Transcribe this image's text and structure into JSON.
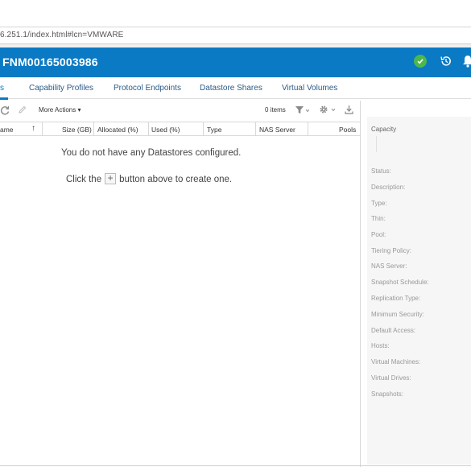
{
  "browser": {
    "address": "6.251.1/index.html#lcn=VMWARE"
  },
  "header": {
    "title": "FNM00165003986"
  },
  "tabs": [
    {
      "label": "s"
    },
    {
      "label": "Capability Profiles"
    },
    {
      "label": "Protocol Endpoints"
    },
    {
      "label": "Datastore Shares"
    },
    {
      "label": "Virtual Volumes"
    }
  ],
  "toolbar": {
    "more_actions": "More Actions",
    "items_count": "0 items"
  },
  "table": {
    "columns": [
      "ame",
      "Size (GB)",
      "Allocated (%)",
      "Used (%)",
      "Type",
      "NAS Server",
      "Pools"
    ]
  },
  "empty": {
    "message": "You do not have any Datastores configured.",
    "create_prefix": "Click the",
    "create_plus": "+",
    "create_suffix": "button above to create one."
  },
  "details": {
    "capacity": "Capacity",
    "properties": [
      "Status:",
      "Description:",
      "Type:",
      "Thin:",
      "Pool:",
      "Tiering Policy:",
      "NAS Server:",
      "Snapshot Schedule:",
      "Replication Type:",
      "Minimum Security:",
      "Default Access:",
      "Hosts:",
      "Virtual Machines:",
      "Virtual Drives:",
      "Snapshots:"
    ]
  },
  "colors": {
    "header_blue": "#0b7ac4",
    "status_ok": "#4cb84c"
  }
}
